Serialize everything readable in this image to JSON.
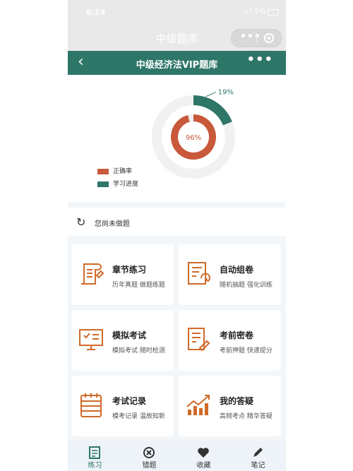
{
  "status_bar": {
    "time": "6:14",
    "signal": "ııl 5G"
  },
  "mini_nav": {
    "title": "中级题库"
  },
  "header": {
    "back": "‹",
    "title": "中级经济法VIP题库",
    "more": "•••"
  },
  "chart_data": {
    "type": "pie",
    "series": [
      {
        "name": "正确率",
        "values": [
          96
        ],
        "label": "96%",
        "color": "#c8593a"
      },
      {
        "name": "学习进度",
        "values": [
          19
        ],
        "label": "19%",
        "color": "#2e7668"
      }
    ]
  },
  "notice": {
    "text": "您尚未做题"
  },
  "cards": [
    {
      "title": "章节练习",
      "subtitle": "历年真题 做题练题",
      "icon": "chapter-icon"
    },
    {
      "title": "自动组卷",
      "subtitle": "随机抽题 强化训练",
      "icon": "auto-paper-icon"
    },
    {
      "title": "模拟考试",
      "subtitle": "模拟考试 随时检测",
      "icon": "mock-exam-icon"
    },
    {
      "title": "考前密卷",
      "subtitle": "考前押题 快速提分",
      "icon": "secret-paper-icon"
    },
    {
      "title": "考试记录",
      "subtitle": "模考记录 温故知新",
      "icon": "exam-record-icon"
    },
    {
      "title": "我的答疑",
      "subtitle": "高频考点 精华答疑",
      "icon": "qa-chart-icon"
    }
  ],
  "tabs": [
    {
      "label": "练习",
      "icon": "practice-icon"
    },
    {
      "label": "错题",
      "icon": "wrong-icon"
    },
    {
      "label": "收藏",
      "icon": "heart-icon"
    },
    {
      "label": "笔记",
      "icon": "pen-icon"
    }
  ],
  "colors": {
    "accent": "#2e7668",
    "orange": "#c8593a"
  }
}
